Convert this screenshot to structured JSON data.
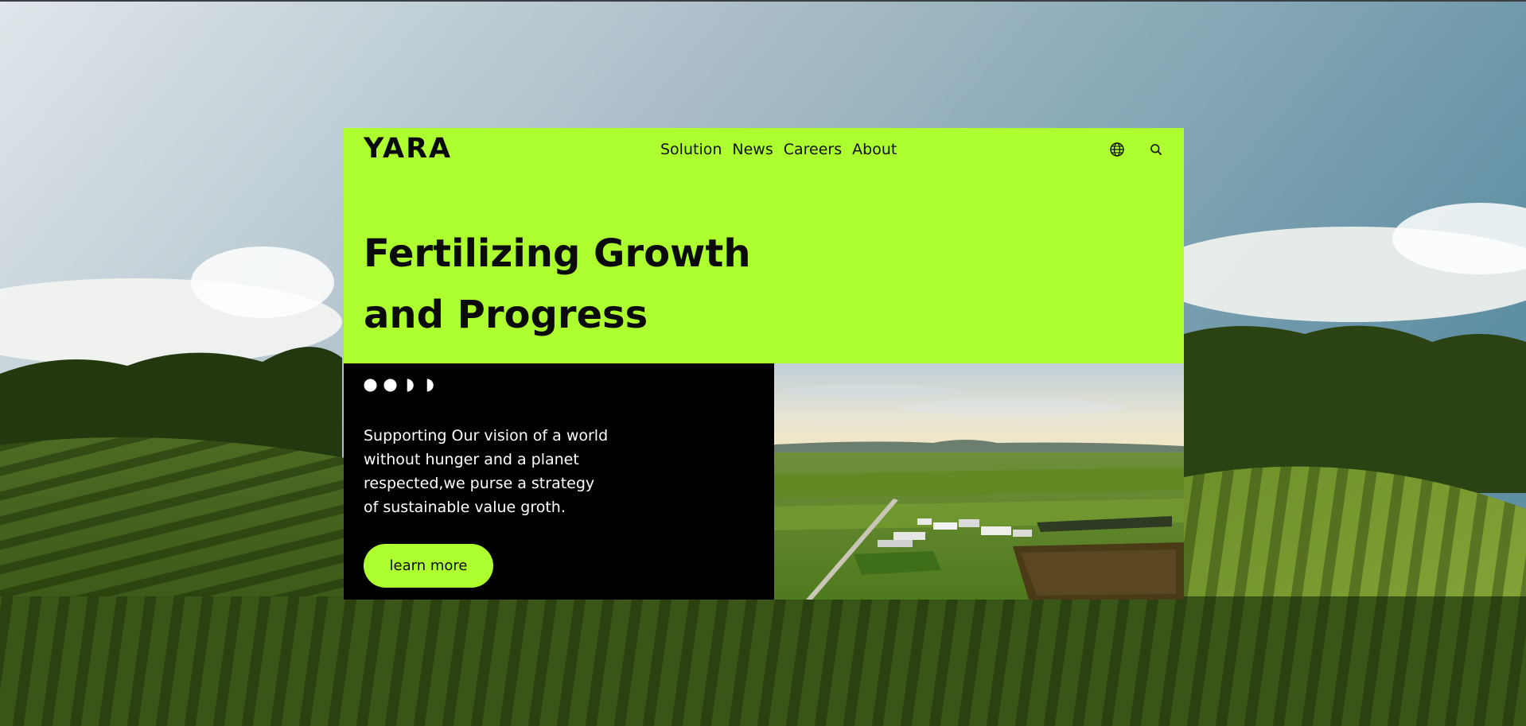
{
  "brand": {
    "logo_text": "YARA",
    "accent_color": "#adff2f",
    "dark_color": "#000000"
  },
  "nav": {
    "items": [
      {
        "label": "Solution"
      },
      {
        "label": "News"
      },
      {
        "label": "Careers"
      },
      {
        "label": "About"
      }
    ]
  },
  "header_icons": {
    "language": "globe-icon",
    "search": "search-icon"
  },
  "hero": {
    "headline_line1": "Fertilizing Growth",
    "headline_line2": "and Progress"
  },
  "intro": {
    "text_line1": "Supporting Our vision of a world",
    "text_line2": "without hunger and a planet",
    "text_line3": "respected,we purse a strategy",
    "text_line4": "of sustainable value groth.",
    "cta_label": "learn more"
  },
  "decor": {
    "dots": [
      "full-circle-icon",
      "full-circle-icon",
      "half-circle-icon",
      "half-circle-icon"
    ]
  },
  "imagery": {
    "background": "vineyard-landscape-photo",
    "card_photo": "aerial-farm-photo"
  }
}
